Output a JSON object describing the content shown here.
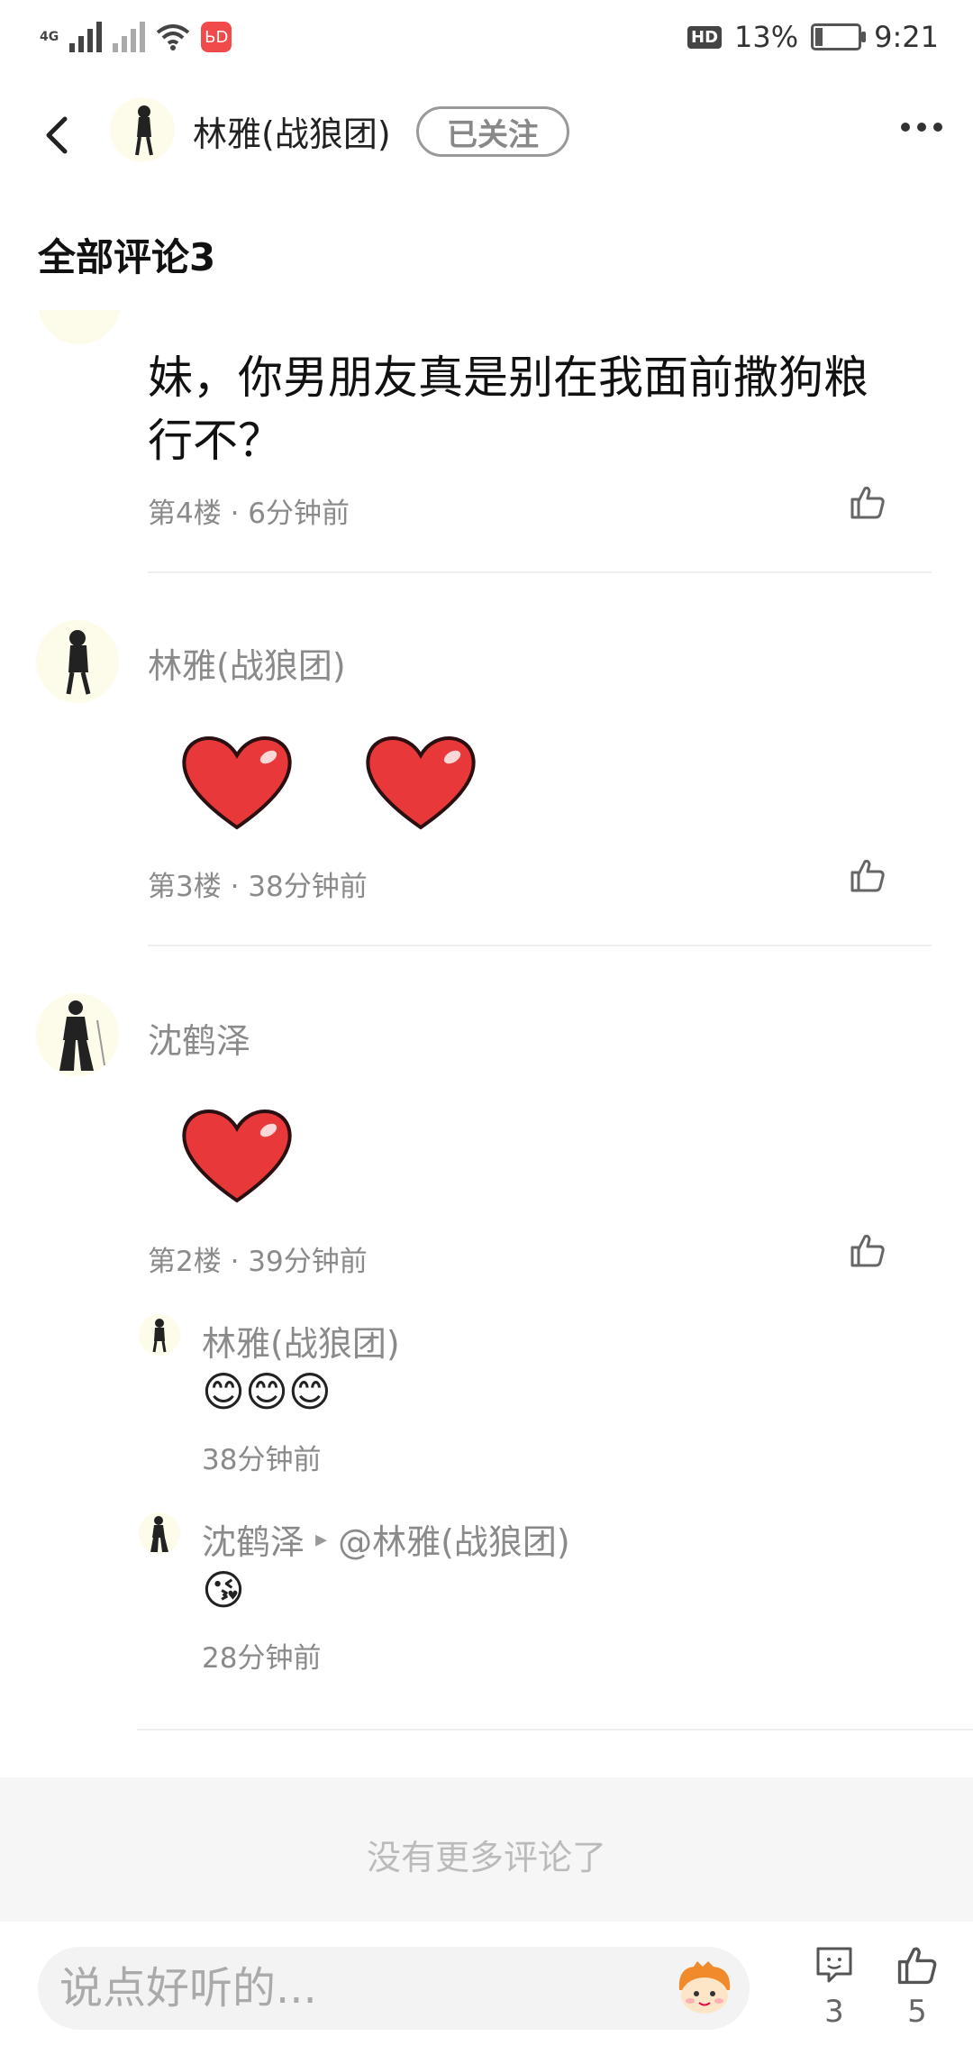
{
  "status_bar": {
    "network1": "4G",
    "battery_percent": "13%",
    "time": "9:21",
    "hd": "HD",
    "app_badge": "ЬD"
  },
  "header": {
    "username": "林雅(战狼团)",
    "follow_label": "已关注"
  },
  "section_title": "全部评论3",
  "comments": [
    {
      "text": "妹，你男朋友真是别在我面前撒狗粮行不？",
      "floor_time": "第4楼 · 6分钟前"
    },
    {
      "username": "林雅(战狼团)",
      "floor_time": "第3楼 · 38分钟前"
    },
    {
      "username": "沈鹤泽",
      "floor_time": "第2楼 · 39分钟前",
      "replies": [
        {
          "username": "林雅(战狼团)",
          "emoji": "😊😊😊",
          "time": "38分钟前"
        },
        {
          "username": "沈鹤泽",
          "arrow": "▸",
          "mention": "@林雅(战狼团)",
          "emoji": "😘",
          "time": "28分钟前"
        }
      ]
    }
  ],
  "no_more": "没有更多评论了",
  "bottom_bar": {
    "input_placeholder": "说点好听的...",
    "comment_count": "3",
    "like_count": "5"
  }
}
